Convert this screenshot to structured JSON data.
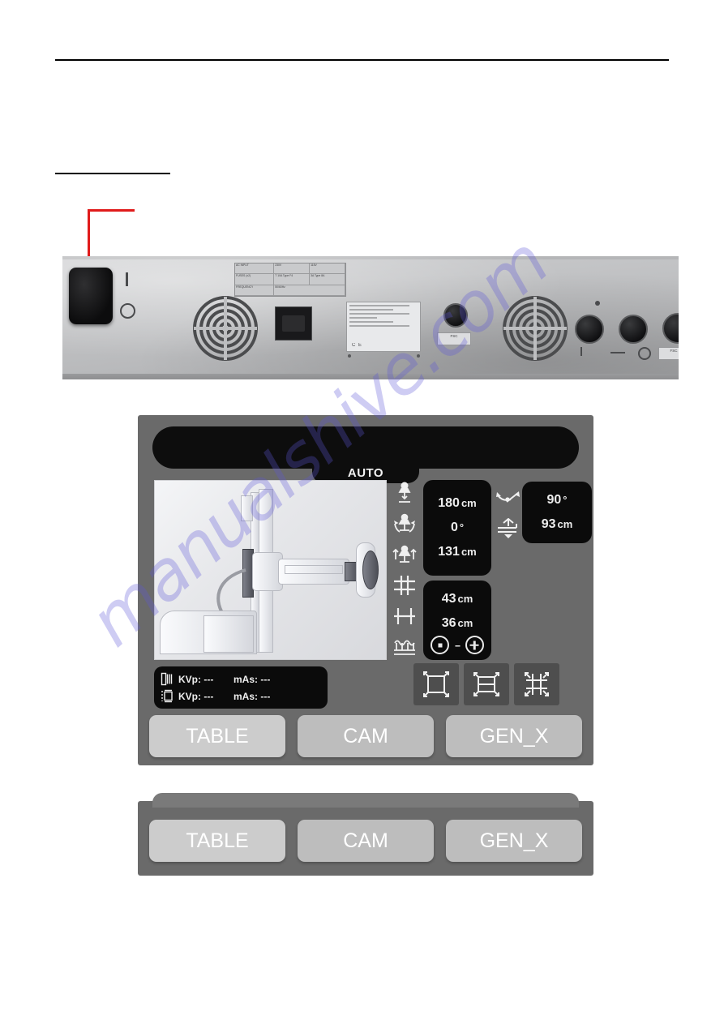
{
  "document": {
    "watermark": "manualshive.com"
  },
  "photo": {
    "caption_alt": "Rear panel of the device",
    "callout_target": "power-switch",
    "switch_marks": {
      "on": "I",
      "off": "O"
    },
    "rating_label": {
      "rows": [
        [
          "AC INPUT",
          "230V",
          "115V"
        ],
        [
          "FUSES (x2)",
          "T 10A Type F4",
          "3A Type 8A"
        ],
        [
          "FREQUENCY",
          "50/60Hz",
          ""
        ]
      ]
    },
    "connector_label": "FSC"
  },
  "ui": {
    "mode_tab": "AUTO",
    "preview_alt": "X-ray tube column and table preview",
    "icons": {
      "sid_height": "sid-height-icon",
      "tube_rotation": "tube-rotation-icon",
      "tube_lateral": "tube-lateral-icon",
      "bucky_grid": "bucky-grid-icon",
      "table_bucky": "table-bucky-icon",
      "scatter": "scatter-wave-icon",
      "tilt": "tilt-angle-icon",
      "vertical_travel": "vertical-travel-icon"
    },
    "main_values": [
      {
        "value": "180",
        "unit": "cm"
      },
      {
        "value": "0",
        "unit": "°"
      },
      {
        "value": "131",
        "unit": "cm"
      }
    ],
    "secondary_values": [
      {
        "value": "43",
        "unit": "cm"
      },
      {
        "value": "36",
        "unit": "cm"
      }
    ],
    "stepper": {
      "minus_label": "decrease",
      "dash": "--",
      "plus_label": "increase"
    },
    "right_values": [
      {
        "value": "90",
        "unit": "°"
      },
      {
        "value": "93",
        "unit": "cm"
      }
    ],
    "exposure": {
      "rows": [
        {
          "icon": "collimator-icon",
          "kvp_label": "KVp:",
          "kvp_value": "---",
          "mas_label": "mAs:",
          "mas_value": "---"
        },
        {
          "icon": "detector-icon",
          "kvp_label": "KVp:",
          "kvp_value": "---",
          "mas_label": "mAs:",
          "mas_value": "---"
        }
      ]
    },
    "collimator_buttons": [
      "collimator-format-1-icon",
      "collimator-format-2-icon",
      "collimator-format-3-icon"
    ],
    "tabs": [
      {
        "label": "TABLE",
        "active": true
      },
      {
        "label": "CAM",
        "active": false
      },
      {
        "label": "GEN_X",
        "active": false
      }
    ]
  },
  "ui_detail": {
    "tabs": [
      {
        "label": "TABLE",
        "active": true
      },
      {
        "label": "CAM",
        "active": false
      },
      {
        "label": "GEN_X",
        "active": false
      }
    ]
  },
  "colors": {
    "panel_bg": "#6a6a6a",
    "display_black": "#0b0b0b",
    "tab_bg": "#bdbdbd",
    "tab_active_bg": "#cccccc",
    "callout_red": "#e01b1b",
    "watermark": "#5c56d6"
  }
}
